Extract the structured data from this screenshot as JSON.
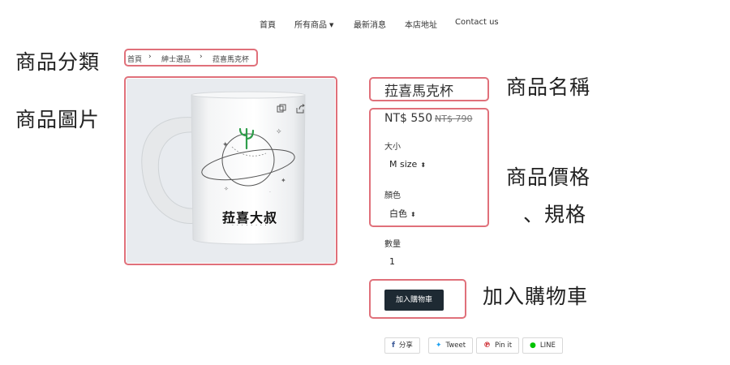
{
  "nav": {
    "items": [
      "首頁",
      "所有商品",
      "最新消息",
      "本店地址",
      "Contact us"
    ]
  },
  "annotations": {
    "category": "商品分類",
    "image": "商品圖片",
    "name": "商品名稱",
    "price_line1": "商品價格",
    "price_line2": "、規格",
    "cart": "加入購物車"
  },
  "breadcrumb": [
    "首頁",
    "紳士選品",
    "菈喜馬克杯"
  ],
  "product": {
    "title": "菈喜馬克杯",
    "price": "NT$ 550",
    "original_price": "NT$ 790",
    "mug_print": "菈喜大叔",
    "mug_subprint": "· · · · · · · ·",
    "size_label": "大小",
    "size_value": "M size",
    "color_label": "顏色",
    "color_value": "白色",
    "qty_label": "數量",
    "qty_value": "1",
    "add_to_cart": "加入購物車"
  },
  "share": {
    "facebook": "分享",
    "twitter": "Tweet",
    "pinterest": "Pin it",
    "line": "LINE"
  },
  "colors": {
    "annotation_box": "#e0707a",
    "cart_button": "#1e2a33",
    "cactus": "#2e9e4a",
    "facebook": "#3b5998",
    "twitter": "#1da1f2",
    "pinterest": "#cb2027",
    "line": "#00c300"
  }
}
